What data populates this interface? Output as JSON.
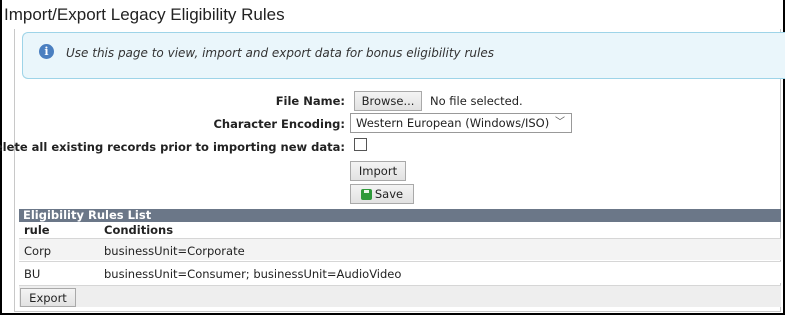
{
  "page": {
    "title": "Import/Export Legacy Eligibility Rules"
  },
  "info": {
    "icon": "info-icon",
    "text": "Use this page to view, import and export data for bonus eligibility rules"
  },
  "form": {
    "file_name_label": "File Name:",
    "browse_label": "Browse...",
    "file_status": "No file selected.",
    "encoding_label": "Character Encoding:",
    "encoding_value": "Western European (Windows/ISO)",
    "delete_label": "Delete all existing records prior to importing new data:",
    "delete_checked": false,
    "import_label": "Import",
    "save_label": "Save"
  },
  "list": {
    "title": "Eligibility Rules List",
    "columns": [
      "rule",
      "Conditions"
    ],
    "rows": [
      {
        "rule": "Corp",
        "conditions": "businessUnit=Corporate"
      },
      {
        "rule": "BU",
        "conditions": "businessUnit=Consumer; businessUnit=AudioVideo"
      }
    ],
    "export_label": "Export"
  }
}
